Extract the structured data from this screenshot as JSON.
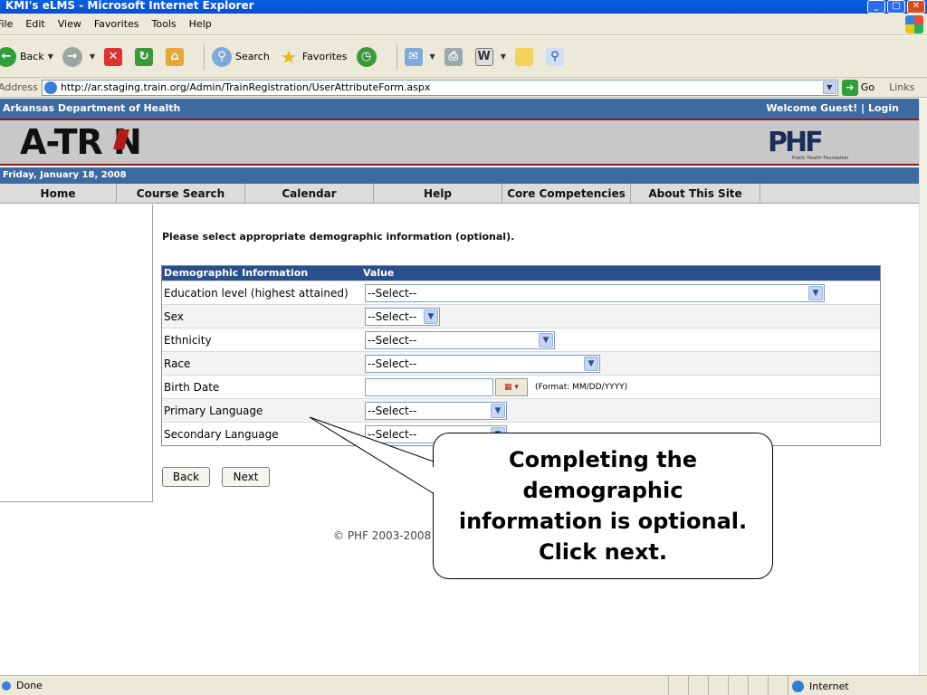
{
  "window": {
    "title": "KMI's eLMS - Microsoft Internet Explorer"
  },
  "menu": [
    "File",
    "Edit",
    "View",
    "Favorites",
    "Tools",
    "Help"
  ],
  "toolbar": {
    "back": "Back",
    "search": "Search",
    "favorites": "Favorites"
  },
  "address": {
    "label": "Address",
    "url": "http://ar.staging.train.org/Admin/TrainRegistration/UserAttributeForm.aspx",
    "go": "Go",
    "links": "Links"
  },
  "site": {
    "org": "Arkansas Department of Health",
    "welcome": "Welcome Guest! | Login",
    "logo": "A-TR N",
    "phf_logo": "PHF",
    "phf_sub": "Public Health Foundation",
    "date": "Friday, January 18, 2008"
  },
  "nav": [
    {
      "label": "Home",
      "width": 129
    },
    {
      "label": "Course Search",
      "width": 142
    },
    {
      "label": "Calendar",
      "width": 142
    },
    {
      "label": "Help",
      "width": 142
    },
    {
      "label": "Core Competencies",
      "width": 142
    },
    {
      "label": "About This Site",
      "width": 143
    }
  ],
  "form": {
    "instructions": "Please select appropriate demographic information (optional).",
    "header_info": "Demographic Information",
    "header_value": "Value",
    "rows": [
      {
        "label": "Education level (highest attained)",
        "value": "--Select--"
      },
      {
        "label": "Sex",
        "value": "--Select--"
      },
      {
        "label": "Ethnicity",
        "value": "--Select--"
      },
      {
        "label": "Race",
        "value": "--Select--"
      },
      {
        "label": "Birth Date",
        "value": "",
        "format": "(Format: MM/DD/YYYY)"
      },
      {
        "label": "Primary Language",
        "value": "--Select--"
      },
      {
        "label": "Secondary Language",
        "value": "--Select--"
      }
    ],
    "back": "Back",
    "next": "Next"
  },
  "footer": "© PHF 2003-2008",
  "callout": "Completing the demographic information is optional. Click next.",
  "status": {
    "done": "Done",
    "zone": "Internet"
  }
}
